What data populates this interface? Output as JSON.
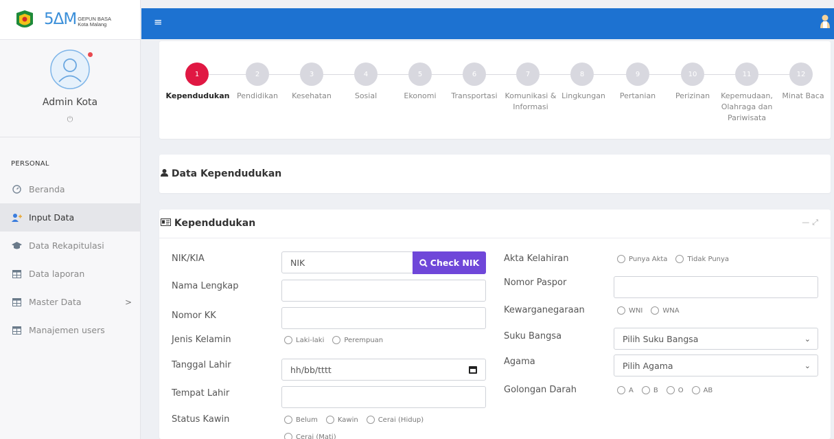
{
  "brand": {
    "logo_text": "5ΔM",
    "logo_sub_1": "GEPUN BASA",
    "logo_sub_2": "Kota Malang"
  },
  "profile": {
    "name": "Admin Kota"
  },
  "nav": {
    "section_label": "PERSONAL",
    "items": [
      {
        "label": "Beranda",
        "icon": "dashboard-icon"
      },
      {
        "label": "Input Data",
        "icon": "user-add-icon"
      },
      {
        "label": "Data Rekapitulasi",
        "icon": "graduation-cap-icon"
      },
      {
        "label": "Data laporan",
        "icon": "table-icon"
      },
      {
        "label": "Master Data",
        "icon": "table-icon"
      },
      {
        "label": "Manajemen users",
        "icon": "table-icon"
      }
    ]
  },
  "steps": [
    {
      "num": "1",
      "label": "Kependudukan"
    },
    {
      "num": "2",
      "label": "Pendidikan"
    },
    {
      "num": "3",
      "label": "Kesehatan"
    },
    {
      "num": "4",
      "label": "Sosial"
    },
    {
      "num": "5",
      "label": "Ekonomi"
    },
    {
      "num": "6",
      "label": "Transportasi"
    },
    {
      "num": "7",
      "label": "Komunikasi & Informasi"
    },
    {
      "num": "8",
      "label": "Lingkungan"
    },
    {
      "num": "9",
      "label": "Pertanian"
    },
    {
      "num": "10",
      "label": "Perizinan"
    },
    {
      "num": "11",
      "label": "Kepemudaan, Olahraga dan Pariwisata"
    },
    {
      "num": "12",
      "label": "Minat Baca"
    }
  ],
  "section_title": "Data Kependudukan",
  "form": {
    "title": "Kependudukan",
    "left": {
      "nik_label": "NIK/KIA",
      "nik_placeholder": "NIK",
      "check_button": "Check NIK",
      "nama_label": "Nama Lengkap",
      "kk_label": "Nomor KK",
      "gender_label": "Jenis Kelamin",
      "gender_opt1": "Laki-laki",
      "gender_opt2": "Perempuan",
      "tgl_label": "Tanggal Lahir",
      "tgl_placeholder": "hh/bb/tttt",
      "tempat_label": "Tempat Lahir",
      "status_label": "Status Kawin",
      "status_opt1": "Belum",
      "status_opt2": "Kawin",
      "status_opt3": "Cerai (Hidup)",
      "status_opt4": "Cerai (Mati)"
    },
    "right": {
      "akta_label": "Akta Kelahiran",
      "akta_opt1": "Punya Akta",
      "akta_opt2": "Tidak Punya",
      "paspor_label": "Nomor Paspor",
      "warga_label": "Kewarganegaraan",
      "warga_opt1": "WNI",
      "warga_opt2": "WNA",
      "suku_label": "Suku Bangsa",
      "suku_value": "Pilih Suku Bangsa",
      "agama_label": "Agama",
      "agama_value": "Pilih Agama",
      "darah_label": "Golongan Darah",
      "darah_opt1": "A",
      "darah_opt2": "B",
      "darah_opt3": "O",
      "darah_opt4": "AB"
    }
  }
}
